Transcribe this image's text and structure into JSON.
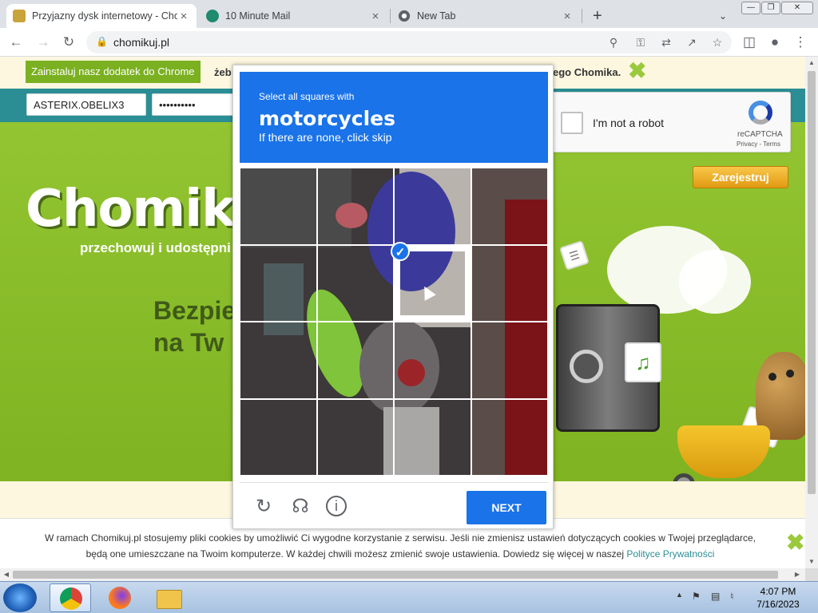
{
  "browser": {
    "tabs": [
      {
        "title": "Przyjazny dysk internetowy - Cho",
        "active": true
      },
      {
        "title": "10 Minute Mail",
        "active": false
      },
      {
        "title": "New Tab",
        "active": false
      }
    ],
    "new_tab_symbol": "+",
    "tab_close_symbol": "×",
    "url": "chomikuj.pl",
    "window_controls": {
      "minimize": "—",
      "restore": "❐",
      "close": "✕"
    }
  },
  "page": {
    "notice": {
      "install_button": "Zainstaluj nasz dodatek do Chrome",
      "text_left": "żeb",
      "text_right": "ego Chomika.",
      "close_symbol": "✖"
    },
    "login": {
      "username_value": "ASTERIX.OBELIX3",
      "password_value": "••••••••••"
    },
    "logo": "Chomikuj.",
    "tagline": "przechowuj i udostępni",
    "headline_line1": "Bezpie",
    "headline_line2": "na Tw",
    "register_button": "Zarejestruj",
    "cookie": {
      "line1": "W ramach Chomikuj.pl stosujemy pliki cookies by umożliwić Ci wygodne korzystanie z serwisu. Jeśli nie zmienisz ustawień dotyczących cookies w Twojej przeglądarce,",
      "line2": "będą one umieszczane na Twoim komputerze. W każdej chwili możesz zmienić swoje ustawienia. Dowiedz się więcej w naszej",
      "link": "Polityce Prywatności",
      "close_symbol": "✖"
    }
  },
  "captcha": {
    "instruction": "Select all squares with",
    "target": "motorcycles",
    "hint": "If there are none, click skip",
    "grid_size": 4,
    "selected_cells": [
      [
        1,
        2
      ]
    ],
    "next_button": "NEXT",
    "footer_icons": [
      "reload-icon",
      "audio-icon",
      "info-icon"
    ]
  },
  "recaptcha_widget": {
    "label": "I'm not a robot",
    "brand": "reCAPTCHA",
    "terms": "Privacy - Terms",
    "checked": false
  },
  "taskbar": {
    "apps": [
      "chrome-icon",
      "firefox-icon",
      "explorer-icon"
    ],
    "time": "4:07 PM",
    "date": "7/16/2023",
    "tray_arrow": "▲"
  },
  "colors": {
    "captcha_blue": "#1a73e8",
    "site_green": "#8ec02c",
    "site_teal": "#2a8e94"
  }
}
